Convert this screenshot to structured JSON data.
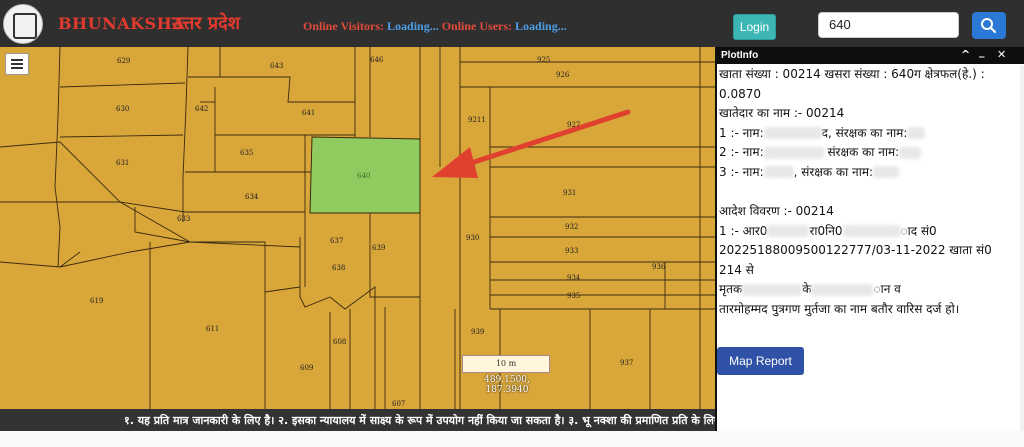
{
  "header": {
    "brand_latin": "BHUNAKSHA",
    "brand_hindi": "उत्तर प्रदेश",
    "visitors_label": "Online Visitors:",
    "visitors_value": "Loading...",
    "users_label": "Online Users:",
    "users_value": "Loading...",
    "login_label": "Login",
    "search_value": "640",
    "icons": {
      "logo": "up-state-emblem",
      "search": "search-icon"
    }
  },
  "map": {
    "highlighted_plot": "640",
    "plots": [
      "629",
      "643",
      "646",
      "630",
      "642",
      "641",
      "631",
      "635",
      "634",
      "633",
      "640",
      "637",
      "639",
      "638",
      "619",
      "611",
      "608",
      "609",
      "607",
      "925",
      "926",
      "9211",
      "927",
      "931",
      "932",
      "933",
      "930",
      "934",
      "935",
      "936",
      "939",
      "937"
    ],
    "scale_label": "10 m",
    "coordinates": "489.1500, 187.3940",
    "ticker": "१. यह प्रति मात्र जानकारी के लिए है। २. इसका न्यायालय में साक्ष्य के रूप में उपयोग नहीं किया जा सकता है। ३. भू नक्शा की प्रमाणित प्रति के लिए कृपया"
  },
  "panel": {
    "title": "PlotInfo",
    "controls": [
      "^",
      "_",
      "✕"
    ],
    "lines": [
      "खाता संख्या : 00214 खसरा संख्या : 640ग क्षेत्रफल(हे.) :",
      "0.0870",
      "खातेदार का नाम :- 00214",
      "1 :- नाम:",
      "द, संरक्षक का नाम:",
      "2 :- नाम:",
      " संरक्षक का नाम:",
      "3 :- नाम:",
      ", संरक्षक का नाम:",
      "आदेश विवरण :- 00214",
      "1 :- आर0",
      "रा0नि0",
      "ाद सं0",
      "20225188009500122777/03-11-2022 खाता सं0 214 से",
      "मृतक",
      "के",
      "ान व",
      "तारमोहम्मद पुत्रगण मुर्तजा का नाम बतौर वारिस दर्ज हो।"
    ],
    "map_report_label": "Map Report"
  },
  "colors": {
    "parcel": "#d9a63a",
    "highlight": "#8fcb5e",
    "arrow": "#e0412e",
    "accent": "#2a79d6"
  }
}
